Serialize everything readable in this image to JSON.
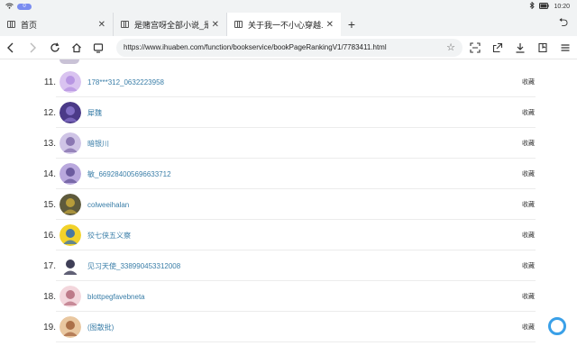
{
  "status": {
    "time": "10:20",
    "badge": "0"
  },
  "tabs": [
    {
      "title": "首页",
      "close": "✕",
      "active": false
    },
    {
      "title": "是赌宫呀全部小说_是...",
      "close": "✕",
      "active": false
    },
    {
      "title": "关于我一不小心穿越...",
      "close": "✕",
      "active": true
    }
  ],
  "tabbar": {
    "new_tab": "+",
    "undo": "⮌"
  },
  "toolbar": {
    "back": "‹",
    "forward": "›",
    "reload": "↻",
    "home": "⌂",
    "url": "https://www.ihuaben.com/function/bookservice/bookPageRankingV1/7783411.html",
    "star": "☆"
  },
  "ranking": [
    {
      "rank": "11.",
      "name": "178***312_0632223958",
      "fav": "收藏",
      "avatar_color": "#d9c3f0",
      "avatar_accent": "#b28ee0"
    },
    {
      "rank": "12.",
      "name": "犀魏",
      "fav": "收藏",
      "avatar_color": "#4b3a88",
      "avatar_accent": "#8b78d0"
    },
    {
      "rank": "13.",
      "name": "暗银川",
      "fav": "收藏",
      "avatar_color": "#cfc4e6",
      "avatar_accent": "#7e6aa8"
    },
    {
      "rank": "14.",
      "name": "敏_669284005696633712",
      "fav": "收藏",
      "avatar_color": "#b9a8dd",
      "avatar_accent": "#5e4e93"
    },
    {
      "rank": "15.",
      "name": "colweeihalan",
      "fav": "收藏",
      "avatar_color": "#5e5a3c",
      "avatar_accent": "#c7a83a"
    },
    {
      "rank": "16.",
      "name": "狡七侠五义察",
      "fav": "收藏",
      "avatar_color": "#f2d22a",
      "avatar_accent": "#2b68b6"
    },
    {
      "rank": "17.",
      "name": "见习天使_338990453312008",
      "fav": "收藏",
      "avatar_color": "#ffffff",
      "avatar_accent": "#1d1d3a"
    },
    {
      "rank": "18.",
      "name": "blottpegfavebneta",
      "fav": "收藏",
      "avatar_color": "#f3d6dc",
      "avatar_accent": "#b36a7a"
    },
    {
      "rank": "19.",
      "name": "(图散批)",
      "fav": "收藏",
      "avatar_color": "#e9c7a0",
      "avatar_accent": "#a0603a"
    }
  ]
}
